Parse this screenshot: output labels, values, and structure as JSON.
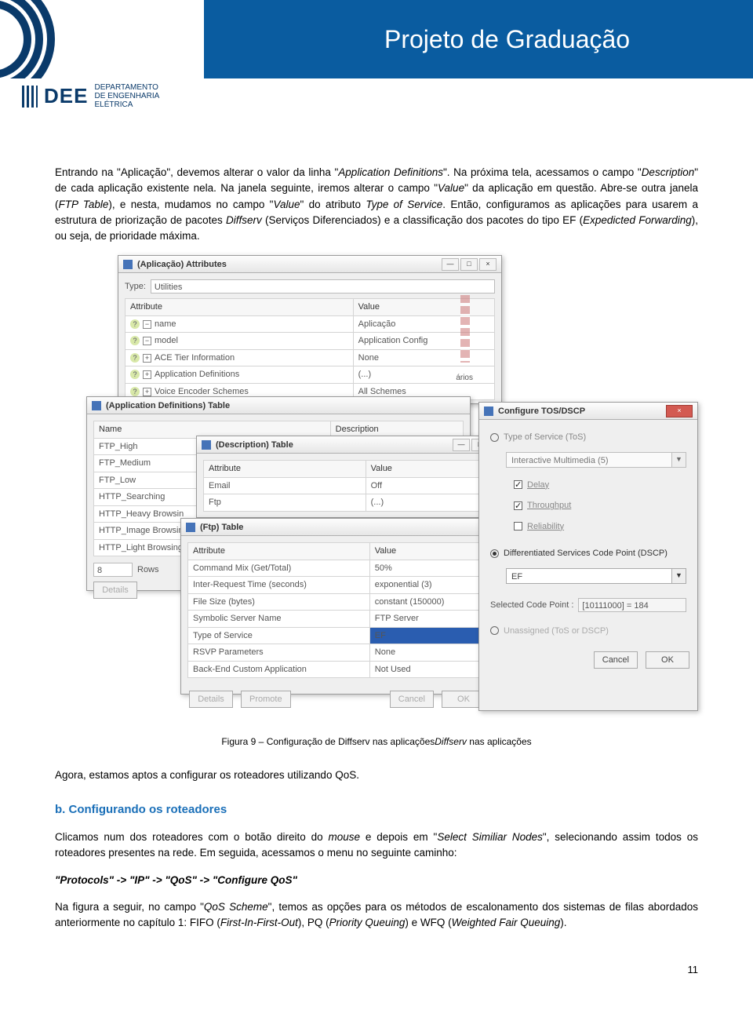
{
  "header": {
    "title": "Projeto de Graduação"
  },
  "dee": {
    "logo": "DEE",
    "line1": "DEPARTAMENTO",
    "line2": "DE ENGENHARIA",
    "line3": "ELÉTRICA"
  },
  "paragraphs": {
    "p1a": "Entrando na \"Aplicação\", devemos alterar o valor da linha \"",
    "p1i1": "Application Definitions",
    "p1b": "\". Na próxima tela, acessamos o campo \"",
    "p1i2": "Description",
    "p1c": "\" de cada aplicação existente nela. Na janela seguinte, iremos alterar o campo \"",
    "p1i3": "Value",
    "p1d": "\" da aplicação em questão. Abre-se outra janela (",
    "p1i4": "FTP Table",
    "p1e": "), e nesta, mudamos no campo \"",
    "p1i5": "Value",
    "p1f": "\" do atributo ",
    "p1i6": "Type of Service",
    "p1g": ". Então, configuramos as aplicações para usarem a estrutura de priorização de pacotes ",
    "p1i7": "Diffserv",
    "p1h": " (Serviços Diferenciados) e a classificação dos pacotes do tipo EF (",
    "p1i8": "Expedicted Forwarding",
    "p1j": "), ou seja, de prioridade máxima."
  },
  "fig_caption": "Figura 9 – Configuração de Diffserv nas aplicações",
  "p2": "Agora, estamos aptos a configurar os roteadores utilizando QoS.",
  "section_b": "b.   Configurando os roteadores",
  "p3a": "Clicamos num dos roteadores com o botão direito do ",
  "p3i1": "mouse",
  "p3b": " e depois em \"",
  "p3i2": "Select Similiar Nodes",
  "p3c": "\", selecionando assim todos os roteadores presentes na rede. Em seguida, acessamos o menu no seguinte caminho:",
  "menu_path": "\"Protocols\" -> \"IP\" -> \"QoS\" -> \"Configure QoS\"",
  "p4a": "Na figura a seguir, no campo \"",
  "p4i1": "QoS Scheme",
  "p4b": "\", temos as opções para os métodos de escalonamento dos sistemas de filas abordados anteriormente no capítulo 1: FIFO (",
  "p4i2": "First-In-First-Out",
  "p4c": "), PQ (",
  "p4i3": "Priority Queuing",
  "p4d": ") e WFQ (",
  "p4i4": "Weighted Fair Queuing",
  "p4e": ").",
  "pagenum": "11",
  "win_attr": {
    "title": "(Aplicação) Attributes",
    "type_label": "Type:",
    "type_value": "Utilities",
    "col_attr": "Attribute",
    "col_val": "Value",
    "rows": [
      {
        "a": "name",
        "v": "Aplicação"
      },
      {
        "a": "model",
        "v": "Application Config"
      },
      {
        "a": "ACE Tier Information",
        "v": "None"
      },
      {
        "a": "Application Definitions",
        "v": "(...)"
      },
      {
        "a": "Voice Encoder Schemes",
        "v": "All Schemes"
      }
    ],
    "deco_label": "ários"
  },
  "win_appdef": {
    "title": "(Application Definitions) Table",
    "col_name": "Name",
    "col_desc": "Description",
    "names": [
      "FTP_High",
      "FTP_Medium",
      "FTP_Low",
      "HTTP_Searching",
      "HTTP_Heavy Browsin",
      "HTTP_Image Browsin",
      "HTTP_Light Browsing"
    ],
    "desc0": "(...)",
    "rows_label": "Rows",
    "rows_val": "8",
    "details_btn": "Details"
  },
  "win_desc": {
    "title": "(Description) Table",
    "col_attr": "Attribute",
    "col_val": "Value",
    "rows": [
      {
        "a": "Email",
        "v": "Off"
      },
      {
        "a": "Ftp",
        "v": "(...)"
      }
    ]
  },
  "win_ftp": {
    "title": "(Ftp) Table",
    "col_attr": "Attribute",
    "col_val": "Value",
    "rows": [
      {
        "a": "Command Mix (Get/Total)",
        "v": "50%"
      },
      {
        "a": "Inter-Request Time (seconds)",
        "v": "exponential (3)"
      },
      {
        "a": "File Size (bytes)",
        "v": "constant (150000)"
      },
      {
        "a": "Symbolic Server Name",
        "v": "FTP Server"
      },
      {
        "a": "Type of Service",
        "v": "EF"
      },
      {
        "a": "RSVP Parameters",
        "v": "None"
      },
      {
        "a": "Back-End Custom Application",
        "v": "Not Used"
      }
    ],
    "btn_details": "Details",
    "btn_promote": "Promote",
    "btn_cancel": "Cancel",
    "btn_ok": "OK"
  },
  "win_tos": {
    "title": "Configure TOS/DSCP",
    "opt_tos": "Type of Service (ToS)",
    "tos_dd": "Interactive Multimedia (5)",
    "chk_delay": "Delay",
    "chk_throughput": "Throughput",
    "chk_reliability": "Reliability",
    "opt_dscp": "Differentiated Services Code Point (DSCP)",
    "dscp_dd": "EF",
    "sel_label": "Selected Code Point :",
    "sel_val": "[10111000] = 184",
    "opt_unassigned": "Unassigned (ToS or DSCP)",
    "btn_cancel": "Cancel",
    "btn_ok": "OK"
  }
}
